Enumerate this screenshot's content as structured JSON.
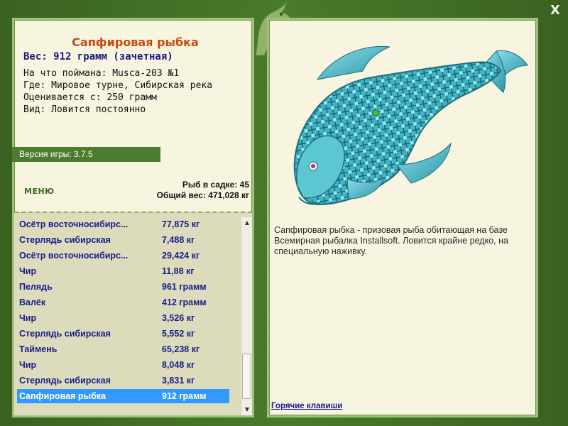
{
  "close_label": "X",
  "fish": {
    "name": "Сапфировая рыбка",
    "weight": "Вес: 912 грамм (зачетная)",
    "bait": "На что поймана: Musca-203 №1",
    "where": "Где: Мировое турне, Сибирская река",
    "value": "Оценивается с: 250 грамм",
    "kind": "Вид: Ловится постоянно"
  },
  "version": "Версия игры: 3.7.5",
  "menu_label": "МЕНЮ",
  "stats": {
    "count": "Рыб в садке: 45",
    "total": "Общий вес: 471,028 кг"
  },
  "catch_list": [
    {
      "name": "Осётр восточносибирс...",
      "weight": "77,875 кг"
    },
    {
      "name": "Стерлядь сибирская",
      "weight": "7,488 кг"
    },
    {
      "name": "Осётр восточносибирс...",
      "weight": "29,424 кг"
    },
    {
      "name": "Чир",
      "weight": "11,88 кг"
    },
    {
      "name": "Пелядь",
      "weight": "961 грамм"
    },
    {
      "name": "Валёк",
      "weight": "412 грамм"
    },
    {
      "name": "Чир",
      "weight": "3,526 кг"
    },
    {
      "name": "Стерлядь сибирская",
      "weight": "5,552 кг"
    },
    {
      "name": "Таймень",
      "weight": "65,238 кг"
    },
    {
      "name": "Чир",
      "weight": "8,048 кг"
    },
    {
      "name": "Стерлядь сибирская",
      "weight": "3,831 кг"
    },
    {
      "name": "Сапфировая рыбка",
      "weight": "912 грамм",
      "selected": true
    }
  ],
  "description": "Сапфировая рыбка - призовая рыба обитающая на базе Всемирная рыбалка Installsoft. Ловится крайне редко, на специальную наживку.",
  "hotkeys_label": "Горячие клавиши",
  "colors": {
    "frame": "#4a7a2a",
    "panel": "#f7f4e0",
    "fish_name": "#c64a10",
    "list_text": "#1a1a8c",
    "selected": "#3399ff"
  },
  "icons": {
    "logo": "fish-logo-icon",
    "close": "close-icon"
  }
}
